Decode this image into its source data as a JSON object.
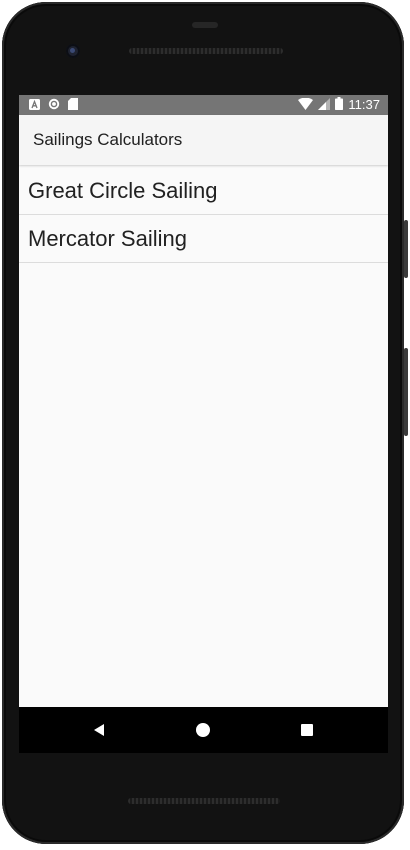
{
  "status_bar": {
    "time": "11:37",
    "left_icons": [
      "a-notification-icon",
      "sync-circle-icon",
      "sd-card-icon"
    ],
    "right_icons": [
      "wifi-icon",
      "signal-icon",
      "battery-icon"
    ]
  },
  "action_bar": {
    "title": "Sailings Calculators"
  },
  "list": {
    "items": [
      {
        "label": "Great Circle Sailing"
      },
      {
        "label": "Mercator Sailing"
      }
    ]
  },
  "nav_bar": {
    "buttons": [
      "back-icon",
      "home-icon",
      "recents-icon"
    ]
  },
  "colors": {
    "status_bar_bg": "#757575",
    "action_bar_bg": "#f5f5f5",
    "screen_bg": "#fafafa",
    "text": "#212121",
    "divider": "#dcdcdc",
    "phone_body": "#121212"
  }
}
